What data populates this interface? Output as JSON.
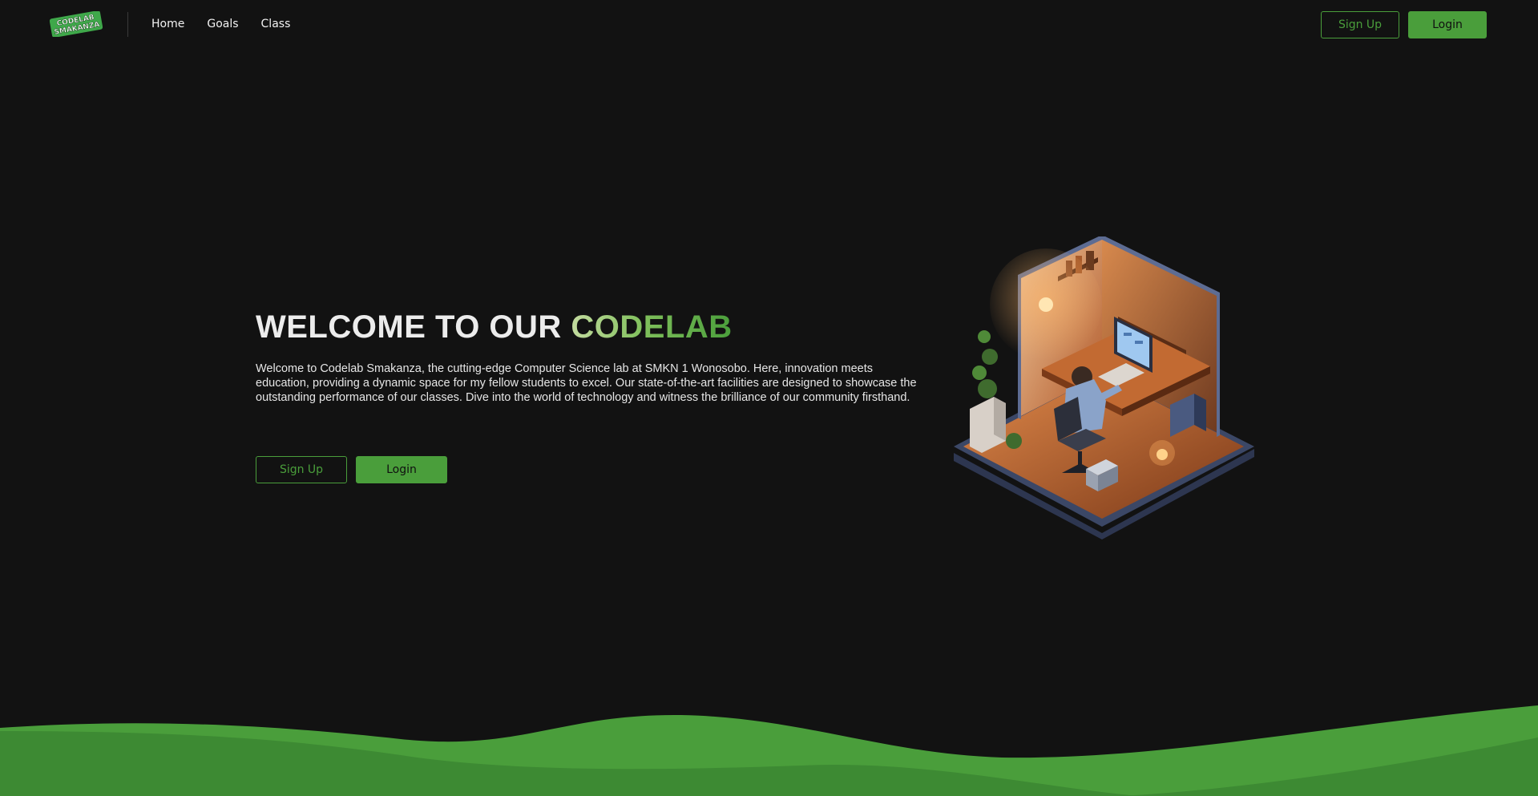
{
  "nav": {
    "logo_line1": "CODELAB",
    "logo_line2": "SMAKANZA",
    "links": [
      "Home",
      "Goals",
      "Class"
    ],
    "signup_label": "Sign Up",
    "login_label": "Login"
  },
  "hero": {
    "title_main": "WELCOME TO OUR ",
    "title_accent": "CODELAB",
    "description": "Welcome to Codelab Smakanza, the cutting-edge Computer Science lab at SMKN 1 Wonosobo. Here, innovation meets education, providing a dynamic space for my fellow students to excel. Our state-of-the-art facilities are designed to showcase the outstanding performance of our classes. Dive into the world of technology and witness the brilliance of our community firsthand.",
    "signup_label": "Sign Up",
    "login_label": "Login",
    "illustration_icon": "isometric-computer-room-illustration"
  },
  "colors": {
    "background": "#121212",
    "accent": "#4a9e3b",
    "accent_light": "#c4dca0",
    "wave_dark": "#3d8a33"
  }
}
